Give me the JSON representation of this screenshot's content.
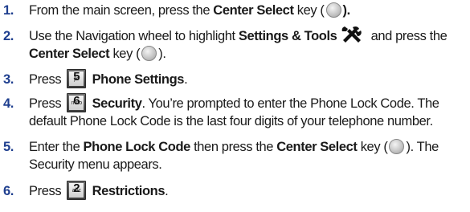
{
  "steps": [
    {
      "number": "1.",
      "text_a": "From the main screen, press the ",
      "bold_a": "Center Select",
      "text_b": " key (",
      "text_c": ")."
    },
    {
      "number": "2.",
      "text_a": "Use the Navigation wheel to highlight ",
      "bold_a": "Settings & Tools",
      "text_b": " and press the",
      "bold_b": "Center Select",
      "text_c": " key (",
      "text_d": ")."
    },
    {
      "number": "3.",
      "text_a": "Press ",
      "key_digit": "5",
      "key_letters": "jkl",
      "bold_a": "Phone Settings",
      "text_b": "."
    },
    {
      "number": "4.",
      "text_a": "Press ",
      "key_digit": "6",
      "key_letters": "mno",
      "bold_a": "Security",
      "text_b": ". You’re prompted to enter the Phone Lock Code. The",
      "line2": "default Phone Lock Code is the last four digits of your telephone number."
    },
    {
      "number": "5.",
      "text_a": "Enter the ",
      "bold_a": "Phone Lock Code",
      "text_b": " then press the ",
      "bold_b": "Center Select",
      "text_c": " key (",
      "text_d": "). The",
      "line2": "Security menu appears."
    },
    {
      "number": "6.",
      "text_a": "Press ",
      "key_digit": "2",
      "key_letters": "abc",
      "bold_a": "Restrictions",
      "text_b": "."
    }
  ],
  "colors": {
    "step_number": "#1f3f8f",
    "text": "#1a1a1a"
  },
  "icons": {
    "center_select": "center-select-key-icon",
    "settings_tools": "settings-tools-icon"
  }
}
